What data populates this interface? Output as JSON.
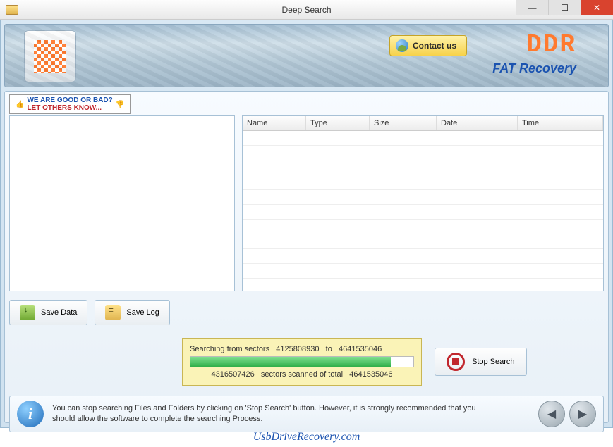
{
  "window": {
    "title": "Deep Search"
  },
  "banner": {
    "contact_label": "Contact us",
    "brand": "DDR",
    "brand_sub": "FAT Recovery"
  },
  "feedback": {
    "line1": "WE ARE GOOD OR BAD?",
    "line2": "LET OTHERS KNOW..."
  },
  "grid": {
    "cols": {
      "name": "Name",
      "type": "Type",
      "size": "Size",
      "date": "Date",
      "time": "Time"
    }
  },
  "buttons": {
    "save_data": "Save Data",
    "save_log": "Save Log",
    "stop_search": "Stop Search"
  },
  "progress": {
    "line1_prefix": "Searching from sectors",
    "from_sector": "4125808930",
    "to_word": "to",
    "to_sector": "4641535046",
    "scanned": "4316507426",
    "mid_text": "sectors scanned of total",
    "total": "4641535046"
  },
  "hint": {
    "text": "You can stop searching Files and Folders by clicking on 'Stop Search' button. However, it is strongly recommended that you should allow the software to complete the searching Process."
  },
  "footer": {
    "link": "UsbDriveRecovery.com"
  }
}
